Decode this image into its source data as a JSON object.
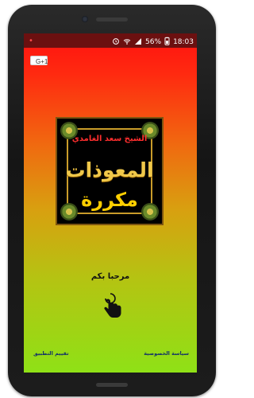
{
  "statusbar": {
    "time": "18:03",
    "battery": "56%",
    "icons": [
      "alarm-icon",
      "wifi-icon",
      "signal-icon",
      "battery-icon"
    ]
  },
  "app": {
    "gplus_label": "G+1",
    "welcome": "مرحبا بكم",
    "privacy_link": "سياسة الخصوصية",
    "rate_link": "تقييم التطبيق",
    "artwork": {
      "line1": "الشيخ سعد الغامدي",
      "line2": "المعوذات",
      "line3": "مكررة"
    }
  }
}
